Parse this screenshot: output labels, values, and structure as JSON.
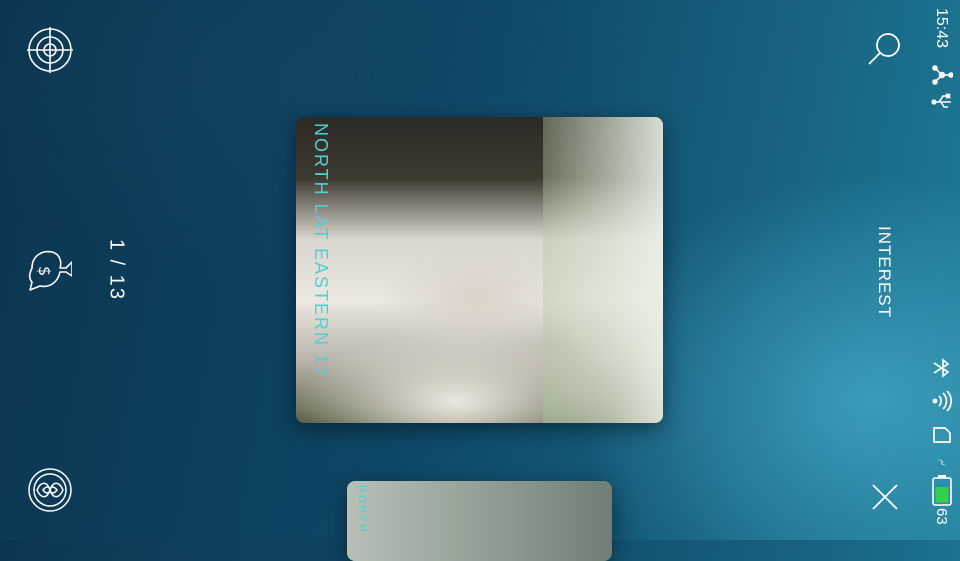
{
  "pager": {
    "counter": "1 / 13"
  },
  "cards": {
    "main": {
      "caption": "NORTH LAT  EASTERN 17"
    },
    "next": {
      "caption": "NORTH"
    }
  },
  "right": {
    "category": "INTEREST"
  },
  "status_bar": {
    "time": "15:43",
    "battery_level": "63"
  },
  "icons": {
    "target": "crosshair-target-icon",
    "money_bag": "money-bag-icon",
    "emblem": "lotus-emblem-icon",
    "search": "search-icon",
    "close": "close-icon",
    "share": "share-icon",
    "usb": "usb-icon",
    "bluetooth": "bluetooth-icon",
    "wifi": "wifi-icon",
    "sim": "sim-card-icon",
    "charging": "charging-bolt-icon",
    "battery": "battery-icon"
  },
  "colors": {
    "caption": "#4fd0d8",
    "battery_fill": "#33d14a"
  }
}
